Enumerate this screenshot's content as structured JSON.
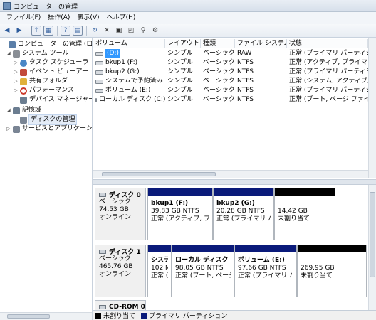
{
  "window": {
    "title": "コンピューターの管理"
  },
  "menu": [
    "ファイル(F)",
    "操作(A)",
    "表示(V)",
    "ヘルプ(H)"
  ],
  "toolbar": {
    "icons": [
      "back-arrow-icon",
      "forward-arrow-icon",
      "up-folder-icon",
      "show-hide-tree-icon",
      "help-icon",
      "properties-pane-icon",
      "refresh-icon",
      "delete-icon",
      "properties-icon",
      "open-icon",
      "search-icon",
      "settings-icon"
    ]
  },
  "tree": {
    "items": [
      {
        "label": "コンピューターの管理 (ロー力",
        "twisty": "",
        "icon": "computer-icon",
        "color": "#5b7fa8"
      },
      {
        "label": "システム ツール",
        "twisty": "◢",
        "icon": "tools-icon",
        "color": "#8a8f96"
      },
      {
        "label": "タスク スケジューラ",
        "twisty": "▷",
        "icon": "clock-icon",
        "color": "#4a86c5"
      },
      {
        "label": "イベント ビューアー",
        "twisty": "▷",
        "icon": "event-viewer-icon",
        "color": "#c24a3a"
      },
      {
        "label": "共有フォルダー",
        "twisty": "▷",
        "icon": "shared-folder-icon",
        "color": "#e0b13a"
      },
      {
        "label": "パフォーマンス",
        "twisty": "▷",
        "icon": "performance-icon",
        "color": "#cc3b2b"
      },
      {
        "label": "デバイス マネージャー",
        "twisty": "",
        "icon": "device-manager-icon",
        "color": "#6b7d90"
      },
      {
        "label": "記憶域",
        "twisty": "◢",
        "icon": "storage-icon",
        "color": "#6b7d90"
      },
      {
        "label": "ディスクの管理",
        "twisty": "",
        "icon": "disk-management-icon",
        "color": "#7a8594"
      },
      {
        "label": "サービスとアプリケーショ",
        "twisty": "▷",
        "icon": "services-icon",
        "color": "#7a8594"
      }
    ]
  },
  "volumes": {
    "columns": [
      "ボリューム",
      "レイアウト",
      "種類",
      "ファイル システム",
      "状態"
    ],
    "rows": [
      [
        "(D:)",
        "シンプル",
        "ベーシック",
        "RAW",
        "正常 (プライマリ パーティション"
      ],
      [
        "bkup1 (F:)",
        "シンプル",
        "ベーシック",
        "NTFS",
        "正常 (アクティブ, プライマリ パ"
      ],
      [
        "bkup2 (G:)",
        "シンプル",
        "ベーシック",
        "NTFS",
        "正常 (プライマリ パーティション"
      ],
      [
        "システムで予約済み",
        "シンプル",
        "ベーシック",
        "NTFS",
        "正常 (システム, アクティブ, プラ"
      ],
      [
        "ボリューム (E:)",
        "シンプル",
        "ベーシック",
        "NTFS",
        "正常 (プライマリ パーティション"
      ],
      [
        "ローカル ディスク (C:)",
        "シンプル",
        "ベーシック",
        "NTFS",
        "正常 (ブート, ページ ファイル, カ"
      ]
    ]
  },
  "disks": [
    {
      "name": "ディスク 0",
      "lines": [
        "ベーシック",
        "74.53 GB",
        "オンライン"
      ],
      "partitions": [
        {
          "name": "bkup1 (F:)",
          "size": "39.83 GB NTFS",
          "status": "正常 (アクティブ, プラ",
          "bar": "#0a1a7a"
        },
        {
          "name": "bkup2 (G:)",
          "size": "20.28 GB NTFS",
          "status": "正常 (プライマリ パ-",
          "bar": "#0a1a7a"
        },
        {
          "name": "",
          "size": "14.42 GB",
          "status": "未割り当て",
          "bar": "#000000"
        }
      ]
    },
    {
      "name": "ディスク 1",
      "lines": [
        "ベーシック",
        "465.76 GB",
        "オンライン"
      ],
      "partitions": [
        {
          "name": "システ",
          "size": "102 MI",
          "status": "正常 (:",
          "bar": "#0a1a7a"
        },
        {
          "name": "ローカル ディスク (",
          "size": "98.05 GB NTFS",
          "status": "正常 (ブート, ページ",
          "bar": "#0a1a7a"
        },
        {
          "name": "ボリューム (E:)",
          "size": "97.66 GB NTFS",
          "status": "正常 (プライマリ パ-",
          "bar": "#0a1a7a"
        },
        {
          "name": "",
          "size": "269.95 GB",
          "status": "未割り当て",
          "bar": "#000000"
        }
      ]
    },
    {
      "name": "CD-ROM 0",
      "lines": [],
      "partitions": []
    }
  ],
  "legend": [
    {
      "label": "未割り当て",
      "color": "#000000"
    },
    {
      "label": "プライマリ パーティション",
      "color": "#0a1a7a"
    }
  ]
}
